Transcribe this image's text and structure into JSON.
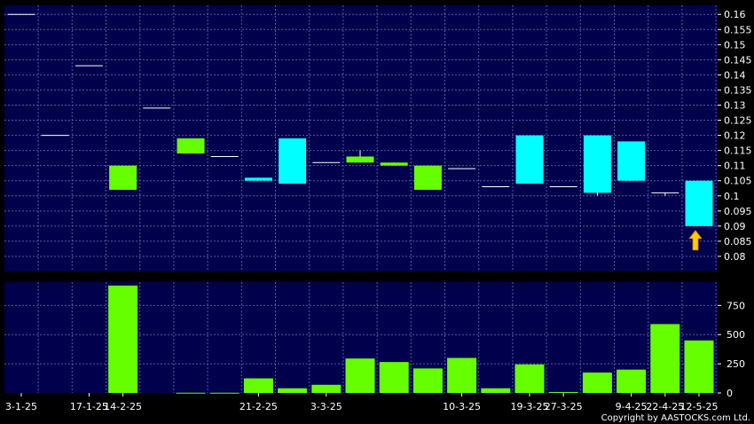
{
  "copyright": "Copyright by AASTOCKS.com Ltd.",
  "colors": {
    "background": "#000000",
    "panel": "#00004d",
    "grid": "#5a5aa0",
    "text": "#ffffff",
    "up": "#00ffff",
    "down": "#66ff00",
    "arrow": "#ffcc00"
  },
  "chart_data": [
    {
      "type": "candlestick",
      "grid": true,
      "y_axis_position": "right",
      "ylim": [
        0.075,
        0.163
      ],
      "yticks": [
        "0.16",
        "0.155",
        "0.15",
        "0.145",
        "0.14",
        "0.135",
        "0.13",
        "0.125",
        "0.12",
        "0.115",
        "0.11",
        "0.105",
        "0.1",
        "0.095",
        "0.09",
        "0.085",
        "0.08"
      ],
      "candles": [
        {
          "open": 0.16,
          "high": 0.16,
          "low": 0.16,
          "close": 0.16
        },
        {
          "open": 0.12,
          "high": 0.12,
          "low": 0.12,
          "close": 0.12
        },
        {
          "open": 0.143,
          "high": 0.143,
          "low": 0.143,
          "close": 0.143
        },
        {
          "open": 0.11,
          "high": 0.11,
          "low": 0.102,
          "close": 0.102
        },
        {
          "open": 0.129,
          "high": 0.129,
          "low": 0.129,
          "close": 0.129
        },
        {
          "open": 0.119,
          "high": 0.119,
          "low": 0.114,
          "close": 0.114
        },
        {
          "open": 0.113,
          "high": 0.113,
          "low": 0.113,
          "close": 0.113
        },
        {
          "open": 0.105,
          "high": 0.106,
          "low": 0.105,
          "close": 0.106
        },
        {
          "open": 0.104,
          "high": 0.119,
          "low": 0.104,
          "close": 0.119
        },
        {
          "open": 0.111,
          "high": 0.111,
          "low": 0.111,
          "close": 0.111
        },
        {
          "open": 0.113,
          "high": 0.115,
          "low": 0.111,
          "close": 0.111
        },
        {
          "open": 0.111,
          "high": 0.111,
          "low": 0.11,
          "close": 0.11
        },
        {
          "open": 0.11,
          "high": 0.11,
          "low": 0.102,
          "close": 0.102
        },
        {
          "open": 0.109,
          "high": 0.109,
          "low": 0.109,
          "close": 0.109
        },
        {
          "open": 0.103,
          "high": 0.103,
          "low": 0.103,
          "close": 0.103
        },
        {
          "open": 0.104,
          "high": 0.12,
          "low": 0.104,
          "close": 0.12
        },
        {
          "open": 0.103,
          "high": 0.103,
          "low": 0.103,
          "close": 0.103
        },
        {
          "open": 0.101,
          "high": 0.12,
          "low": 0.1,
          "close": 0.12
        },
        {
          "open": 0.105,
          "high": 0.118,
          "low": 0.105,
          "close": 0.118
        },
        {
          "open": 0.101,
          "high": 0.101,
          "low": 0.1,
          "close": 0.101
        },
        {
          "open": 0.09,
          "high": 0.105,
          "low": 0.09,
          "close": 0.105
        }
      ],
      "marker": {
        "type": "up-arrow",
        "index": 20,
        "value": 0.085
      }
    },
    {
      "type": "bar",
      "grid": true,
      "y_axis_position": "right",
      "ylim": [
        0,
        950
      ],
      "yticks": [
        "750",
        "500",
        "250",
        "0"
      ],
      "values": [
        0,
        0,
        0,
        920,
        0,
        2,
        2,
        125,
        40,
        70,
        295,
        265,
        210,
        300,
        40,
        245,
        8,
        175,
        200,
        590,
        450
      ],
      "bar_colors": [
        "down",
        "down",
        "down",
        "down",
        "down",
        "down",
        "down",
        "down",
        "down",
        "down",
        "down",
        "down",
        "down",
        "down",
        "down",
        "down",
        "down",
        "down",
        "down",
        "down",
        "down"
      ],
      "x_tick_labels": [
        {
          "index": 0,
          "label": "3-1-25"
        },
        {
          "index": 2,
          "label": "17-1-25"
        },
        {
          "index": 3,
          "label": "14-2-25"
        },
        {
          "index": 7,
          "label": "21-2-25"
        },
        {
          "index": 9,
          "label": "3-3-25"
        },
        {
          "index": 13,
          "label": "10-3-25"
        },
        {
          "index": 15,
          "label": "19-3-25"
        },
        {
          "index": 16,
          "label": "27-3-25"
        },
        {
          "index": 18,
          "label": "9-4-25"
        },
        {
          "index": 19,
          "label": "22-4-25"
        },
        {
          "index": 20,
          "label": "12-5-25"
        }
      ]
    }
  ]
}
